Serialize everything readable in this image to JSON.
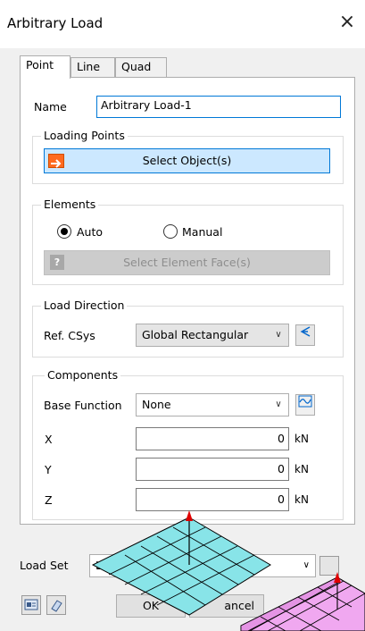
{
  "window": {
    "title": "Arbitrary Load",
    "close_glyph": "×"
  },
  "tabs": [
    "Point",
    "Line",
    "Quad"
  ],
  "name": {
    "label": "Name",
    "value": "Arbitrary Load-1"
  },
  "loading_points": {
    "title": "Loading Points",
    "select_button": "Select Object(s)"
  },
  "elements": {
    "title": "Elements",
    "auto": "Auto",
    "manual": "Manual",
    "selected": "Auto",
    "select_face_button": "Select Element Face(s)",
    "help_glyph": "?"
  },
  "load_direction": {
    "title": "Load Direction",
    "ref_label": "Ref. CSys",
    "ref_value": "Global Rectangular"
  },
  "components": {
    "title": "Components",
    "base_function_label": "Base Function",
    "base_function_value": "None",
    "rows": [
      {
        "label": "X",
        "value": "0",
        "unit": "kN"
      },
      {
        "label": "Y",
        "value": "0",
        "unit": "kN"
      },
      {
        "label": "Z",
        "value": "0",
        "unit": "kN"
      }
    ]
  },
  "load_set": {
    "label": "Load Set",
    "value": "Lo"
  },
  "buttons": {
    "ok": "OK",
    "cancel": "ancel"
  },
  "icons": [
    "close-icon",
    "select-arrow-icon",
    "question-icon",
    "coordinate-system-icon",
    "function-plot-icon",
    "load-set-icon",
    "eraser-icon"
  ],
  "colors": {
    "selected_button": "#cce8ff",
    "focus_border": "#0078d7",
    "mesh_cyan": "#88e4e8",
    "mesh_pink": "#f0a8f0",
    "load_arrow": "#e00000"
  }
}
